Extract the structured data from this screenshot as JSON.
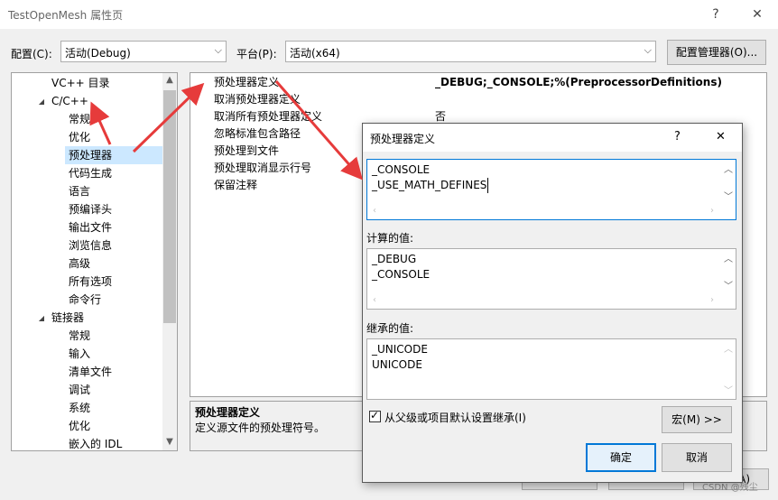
{
  "window": {
    "title": "TestOpenMesh 属性页",
    "help": "?",
    "close": "✕"
  },
  "top_bar": {
    "config_label": "配置(C):",
    "config_value": "活动(Debug)",
    "platform_label": "平台(P):",
    "platform_value": "活动(x64)",
    "config_manager": "配置管理器(O)..."
  },
  "tree": {
    "items": [
      {
        "label": "VC++ 目录"
      },
      {
        "label": "C/C++"
      },
      {
        "label": "常规"
      },
      {
        "label": "优化"
      },
      {
        "label": "预处理器"
      },
      {
        "label": "代码生成"
      },
      {
        "label": "语言"
      },
      {
        "label": "预编译头"
      },
      {
        "label": "输出文件"
      },
      {
        "label": "浏览信息"
      },
      {
        "label": "高级"
      },
      {
        "label": "所有选项"
      },
      {
        "label": "命令行"
      },
      {
        "label": "链接器"
      },
      {
        "label": "常规"
      },
      {
        "label": "输入"
      },
      {
        "label": "清单文件"
      },
      {
        "label": "调试"
      },
      {
        "label": "系统"
      },
      {
        "label": "优化"
      },
      {
        "label": "嵌入的 IDL"
      }
    ]
  },
  "grid": {
    "rows": [
      {
        "name": "预处理器定义",
        "value": "_DEBUG;_CONSOLE;%(PreprocessorDefinitions)"
      },
      {
        "name": "取消预处理器定义",
        "value": ""
      },
      {
        "name": "取消所有预处理器定义",
        "value": "否"
      },
      {
        "name": "忽略标准包含路径",
        "value": ""
      },
      {
        "name": "预处理到文件",
        "value": ""
      },
      {
        "name": "预处理取消显示行号",
        "value": ""
      },
      {
        "name": "保留注释",
        "value": ""
      }
    ]
  },
  "description": {
    "title": "预处理器定义",
    "text": "定义源文件的预处理符号。"
  },
  "dialog": {
    "title": "预处理器定义",
    "help": "?",
    "close": "✕",
    "edit_lines": [
      "_CONSOLE",
      "_USE_MATH_DEFINES"
    ],
    "computed_label": "计算的值:",
    "computed_lines": [
      "_DEBUG",
      "_CONSOLE"
    ],
    "inherited_label": "继承的值:",
    "inherited_lines": [
      "_UNICODE",
      "UNICODE"
    ],
    "inherit_checkbox": "从父级或项目默认设置继承(I)",
    "inherit_checked": true,
    "macros_button": "宏(M) >>",
    "ok_button": "确定",
    "cancel_button": "取消"
  },
  "footer": {
    "partial_button": "A)",
    "watermark": "CSDN @残尘"
  },
  "colors": {
    "selection": "#cce8ff",
    "arrow_red": "#e63b3b",
    "focus_blue": "#0078d7"
  }
}
